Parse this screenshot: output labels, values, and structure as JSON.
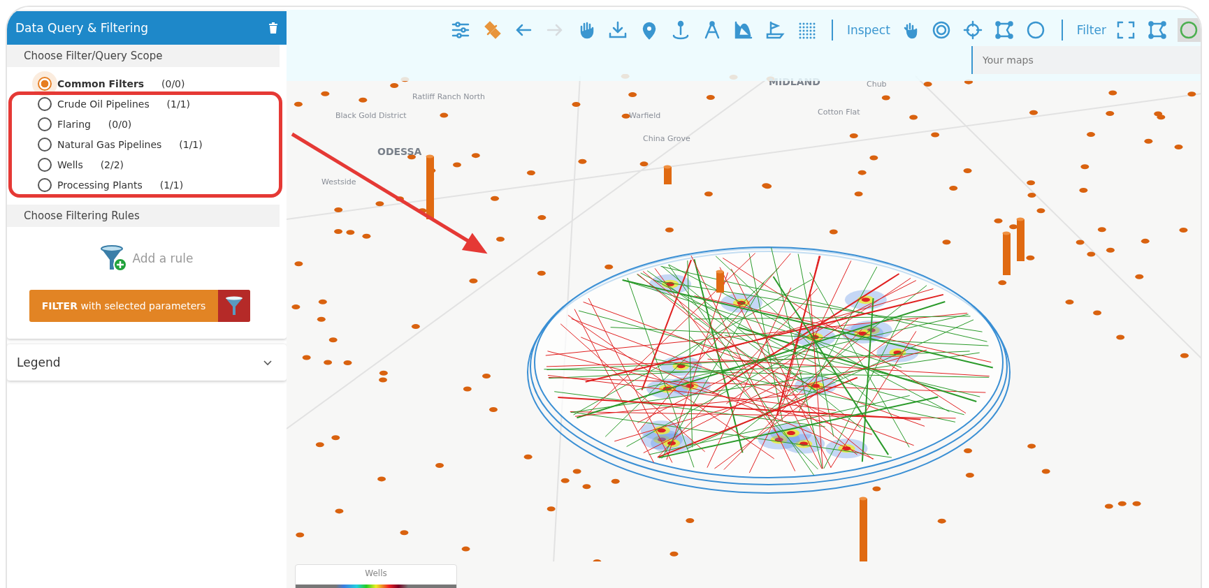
{
  "panel": {
    "title": "Data Query & Filtering",
    "scope_header": "Choose Filter/Query Scope",
    "scopes": [
      {
        "label": "Common Filters",
        "count": "(0/0)",
        "selected": true
      },
      {
        "label": "Crude Oil Pipelines",
        "count": "(1/1)",
        "selected": false
      },
      {
        "label": "Flaring",
        "count": "(0/0)",
        "selected": false
      },
      {
        "label": "Natural Gas Pipelines",
        "count": "(1/1)",
        "selected": false
      },
      {
        "label": "Wells",
        "count": "(2/2)",
        "selected": false
      },
      {
        "label": "Processing Plants",
        "count": "(1/1)",
        "selected": false
      }
    ],
    "rules_header": "Choose Filtering Rules",
    "add_rule": "Add a rule",
    "filter_button": "**FILTER** with selected parameters"
  },
  "legend": {
    "title": "Legend",
    "expanded": false
  },
  "toolbar": {
    "forward_disabled": true,
    "inspect_label": "Inspect",
    "filter_label": "Filter",
    "last_tool_selected": true,
    "your_maps": "Your maps"
  },
  "map_labels": [
    {
      "text": "ODESSA",
      "kind": "city"
    },
    {
      "text": "MIDLAND",
      "kind": "city"
    },
    {
      "text": "Black Gold District",
      "kind": "place"
    },
    {
      "text": "Ratliff Ranch North",
      "kind": "place"
    },
    {
      "text": "Warfield",
      "kind": "place"
    },
    {
      "text": "Westside",
      "kind": "place"
    },
    {
      "text": "China Grove",
      "kind": "place"
    },
    {
      "text": "Cotton Flat",
      "kind": "place"
    },
    {
      "text": "Chub",
      "kind": "place"
    }
  ],
  "heatmap_legend": {
    "title": "Wells"
  }
}
